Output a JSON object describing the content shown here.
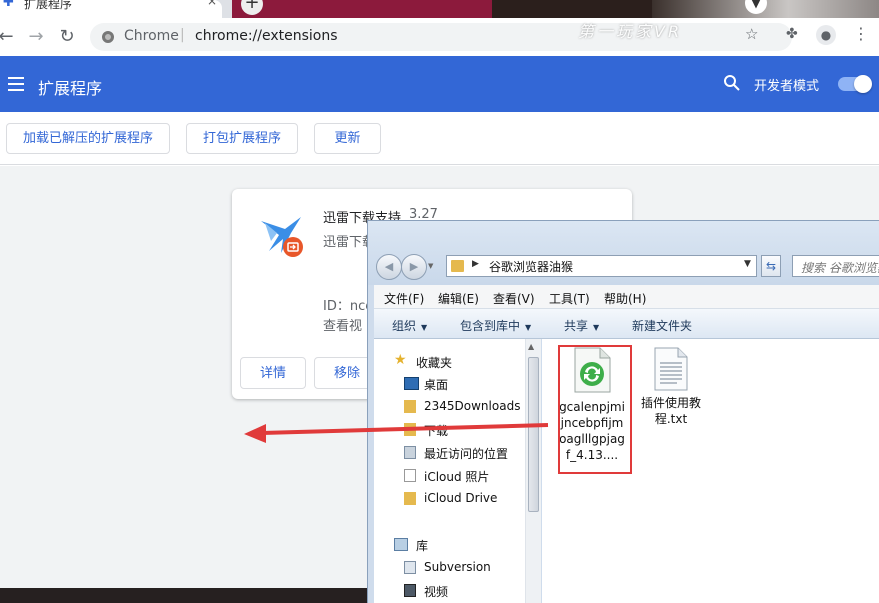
{
  "browser": {
    "tab_title": "扩展程序",
    "tab_close": "×",
    "new_tab": "+",
    "omnibox_site": "Chrome",
    "omnibox_separator": "|",
    "omnibox_url": "chrome://extensions",
    "watermark": "第一玩家VR"
  },
  "extensions_header": {
    "title": "扩展程序",
    "dev_mode_label": "开发者模式",
    "dev_mode_on": true,
    "accent": "#3367d6"
  },
  "actions": {
    "load_unpacked": "加载已解压的扩展程序",
    "pack": "打包扩展程序",
    "update": "更新"
  },
  "extension_card": {
    "name": "迅雷下载支持",
    "version": "3.27",
    "description": "迅雷下载支持",
    "id_label": "ID：nce",
    "view_label": "查看视",
    "details_button": "详情",
    "remove_button": "移除"
  },
  "explorer": {
    "address_path": "谷歌浏览器油猴",
    "search_placeholder": "搜索 谷歌浏览器油猴",
    "menus": [
      "文件(F)",
      "编辑(E)",
      "查看(V)",
      "工具(T)",
      "帮助(H)"
    ],
    "commands": [
      "组织",
      "包含到库中",
      "共享",
      "新建文件夹"
    ],
    "nav_items": [
      "收藏夹",
      "桌面",
      "2345Downloads",
      "下载",
      "最近访问的位置",
      "iCloud 照片",
      "iCloud Drive",
      "库",
      "Subversion",
      "视频"
    ],
    "files": [
      {
        "name": "gcalenpjmijncebpfijmoaglllgpjagf_4.13....",
        "icon": "crx-file-icon",
        "highlighted": true
      },
      {
        "name": "插件使用教程.txt",
        "icon": "text-file-icon",
        "highlighted": false
      }
    ],
    "highlight_color": "#e03a3a"
  }
}
